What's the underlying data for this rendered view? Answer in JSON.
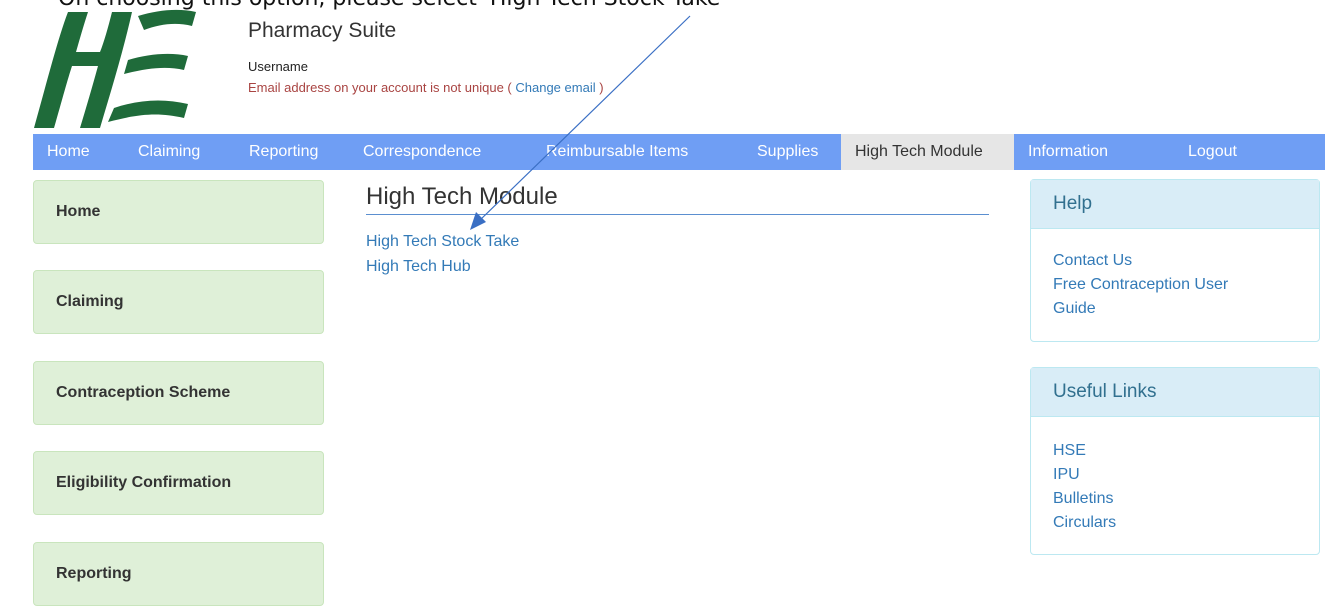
{
  "annotation": {
    "text": "On choosing this option, please select 'High Tech Stock Take'"
  },
  "header": {
    "title": "Pharmacy Suite",
    "username": "Username",
    "email_warning": "Email address on your account is not unique (",
    "change_email": " Change email ",
    "email_warning_end": ")"
  },
  "nav": {
    "items": [
      {
        "label": "Home"
      },
      {
        "label": "Claiming"
      },
      {
        "label": "Reporting"
      },
      {
        "label": "Correspondence"
      },
      {
        "label": "Reimbursable Items"
      },
      {
        "label": "Supplies"
      },
      {
        "label": "High Tech Module",
        "active": true
      },
      {
        "label": "Information"
      },
      {
        "label": "Logout"
      }
    ]
  },
  "sidebar": {
    "items": [
      {
        "label": "Home"
      },
      {
        "label": "Claiming"
      },
      {
        "label": "Contraception Scheme"
      },
      {
        "label": "Eligibility Confirmation"
      },
      {
        "label": "Reporting"
      }
    ]
  },
  "main": {
    "heading": "High Tech Module",
    "links": [
      {
        "label": "High Tech Stock Take"
      },
      {
        "label": "High Tech Hub"
      }
    ]
  },
  "help_panel": {
    "title": "Help",
    "links": [
      {
        "label": "Contact Us"
      },
      {
        "label": "Free Contraception User"
      },
      {
        "label": "Guide"
      }
    ]
  },
  "links_panel": {
    "title": "Useful Links",
    "links": [
      {
        "label": "HSE"
      },
      {
        "label": "IPU"
      },
      {
        "label": "Bulletins"
      },
      {
        "label": "Circulars"
      }
    ]
  },
  "colors": {
    "navbar": "#6f9ef4",
    "nav_active": "#e6e6e6",
    "sidebar_bg": "#dff0d8",
    "panel_head": "#d9edf7",
    "link": "#337ab7",
    "warning": "#a94442",
    "logo_green": "#1f6b3a"
  }
}
